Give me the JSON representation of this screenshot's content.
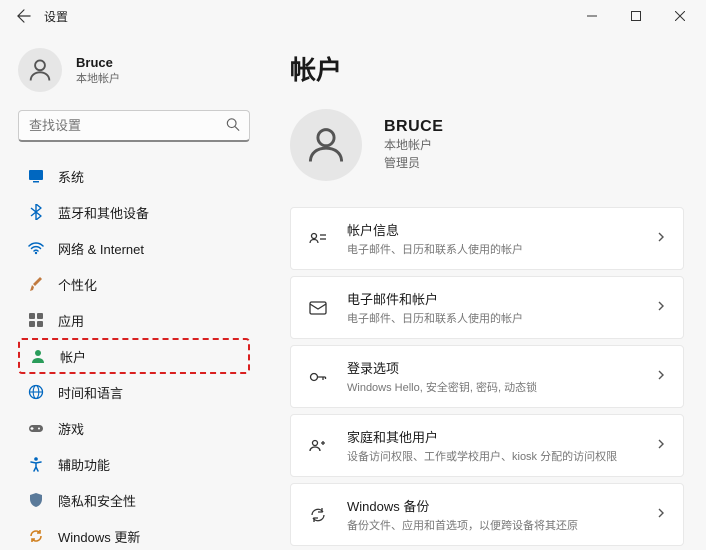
{
  "window": {
    "title": "设置"
  },
  "profile": {
    "name": "Bruce",
    "subtitle": "本地帐户"
  },
  "search": {
    "placeholder": "查找设置"
  },
  "nav": {
    "items": [
      {
        "label": "系统"
      },
      {
        "label": "蓝牙和其他设备"
      },
      {
        "label": "网络 & Internet"
      },
      {
        "label": "个性化"
      },
      {
        "label": "应用"
      },
      {
        "label": "帐户"
      },
      {
        "label": "时间和语言"
      },
      {
        "label": "游戏"
      },
      {
        "label": "辅助功能"
      },
      {
        "label": "隐私和安全性"
      },
      {
        "label": "Windows 更新"
      }
    ]
  },
  "page": {
    "title": "帐户",
    "account": {
      "name": "BRUCE",
      "type": "本地帐户",
      "role": "管理员"
    },
    "cards": [
      {
        "title": "帐户信息",
        "sub": "电子邮件、日历和联系人使用的帐户"
      },
      {
        "title": "电子邮件和帐户",
        "sub": "电子邮件、日历和联系人使用的帐户"
      },
      {
        "title": "登录选项",
        "sub": "Windows Hello, 安全密钥, 密码, 动态锁"
      },
      {
        "title": "家庭和其他用户",
        "sub": "设备访问权限、工作或学校用户、kiosk 分配的访问权限"
      },
      {
        "title": "Windows 备份",
        "sub": "备份文件、应用和首选项，以便跨设备将其还原"
      }
    ]
  }
}
